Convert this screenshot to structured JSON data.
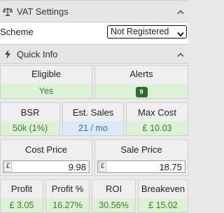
{
  "vat_settings": {
    "title": "VAT Settings",
    "scheme_label": "Scheme",
    "scheme_value": "Not Registered"
  },
  "quick_info": {
    "title": "Quick Info",
    "eligible": {
      "label": "Eligible",
      "value": "Yes"
    },
    "alerts": {
      "label": "Alerts",
      "count": "9"
    },
    "bsr": {
      "label": "BSR",
      "value": "50k (1%)"
    },
    "est_sales": {
      "label": "Est. Sales",
      "value": "21 / mo"
    },
    "max_cost": {
      "label": "Max Cost",
      "value": "£ 10.03"
    },
    "cost_price": {
      "label": "Cost Price",
      "currency": "£",
      "value": "9.98"
    },
    "sale_price": {
      "label": "Sale Price",
      "currency": "£",
      "value": "18.75"
    },
    "profit": {
      "label": "Profit",
      "value": "£ 3.05"
    },
    "profit_pct": {
      "label": "Profit %",
      "value": "16.27%"
    },
    "roi": {
      "label": "ROI",
      "value": "30.56%"
    },
    "breakeven": {
      "label": "Breakeven",
      "value": "£ 15.02"
    }
  },
  "icons": {
    "vat": "scales-icon",
    "quick_info": "lightning-icon",
    "collapse": "chevron-up-icon",
    "select": "chevron-down-icon"
  },
  "colors": {
    "positive_bg": "#dcf1d6",
    "positive_text": "#3d7a2f",
    "info_bg": "#dbeaf7",
    "info_text": "#3a6fa5",
    "badge": "#2e6b2e"
  }
}
